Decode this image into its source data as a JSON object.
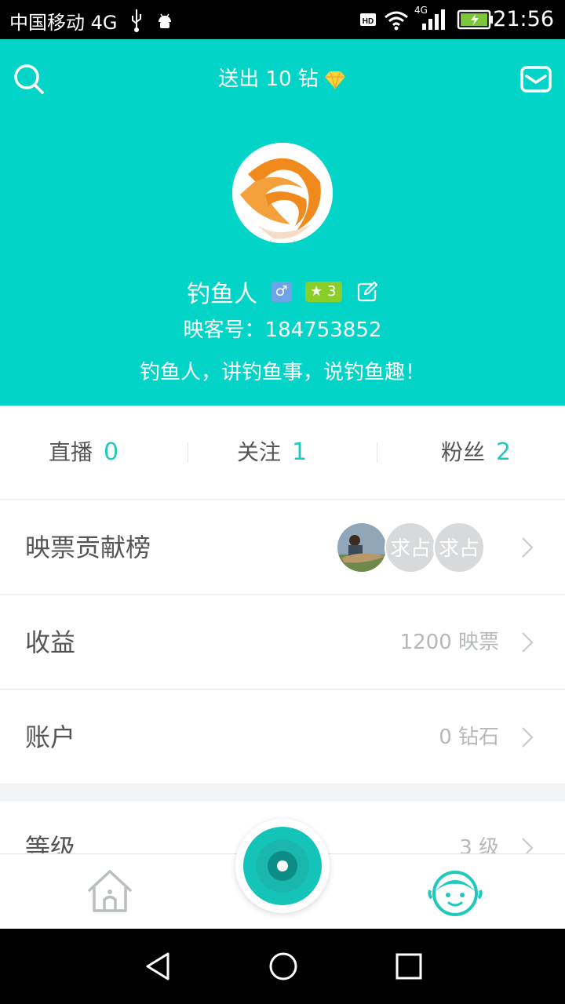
{
  "status_bar": {
    "carrier": "中国移动 4G",
    "time": "21:56",
    "network_label": "4G"
  },
  "header": {
    "gift_title": "送出 10 钻",
    "username": "钓鱼人",
    "gender_symbol": "♂",
    "level": "3",
    "account_id": "映客号：184753852",
    "bio": "钓鱼人，讲钓鱼事，说钓鱼趣！"
  },
  "stats": [
    {
      "label": "直播",
      "count": "0"
    },
    {
      "label": "关注",
      "count": "1"
    },
    {
      "label": "粉丝",
      "count": "2"
    }
  ],
  "menu": {
    "contribution": {
      "label": "映票贡献榜",
      "placeholder_text": "求占"
    },
    "earnings": {
      "label": "收益",
      "value": "1200 映票"
    },
    "account": {
      "label": "账户",
      "value": "0 钻石"
    },
    "level": {
      "label": "等级",
      "value": "3 级"
    }
  },
  "colors": {
    "accent": "#03d4c8",
    "count": "#1fc9bd",
    "level_badge": "#8cce29",
    "gender_badge": "#6fa3e7",
    "avatar_orange": "#f08a1c"
  },
  "icons": [
    "search-icon",
    "mail-icon",
    "diamond-icon",
    "edit-icon",
    "chevron-right-icon",
    "home-icon",
    "live-camera-icon",
    "profile-face-icon",
    "back-icon",
    "home-circle-icon",
    "recents-icon"
  ]
}
